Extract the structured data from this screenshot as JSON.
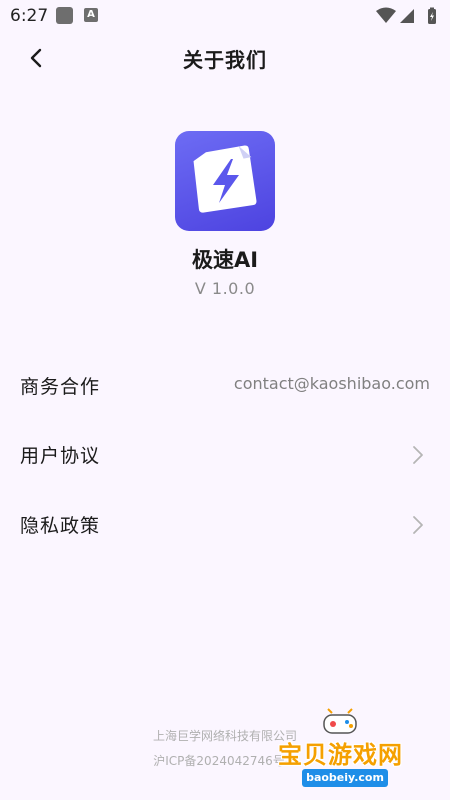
{
  "status_bar": {
    "time": "6:27",
    "notification_badge": "A"
  },
  "header": {
    "title": "关于我们"
  },
  "app": {
    "name": "极速AI",
    "version": "V 1.0.0",
    "brand_color": "#5a55ea"
  },
  "rows": [
    {
      "label": "商务合作",
      "value": "contact@kaoshibao.com"
    },
    {
      "label": "用户协议",
      "value": ""
    },
    {
      "label": "隐私政策",
      "value": ""
    }
  ],
  "footer": {
    "company": "上海巨学网络科技有限公司",
    "icp": "沪ICP备2024042746号-1"
  },
  "watermark": {
    "title": "宝贝游戏网",
    "url": "baobeiy.com"
  }
}
